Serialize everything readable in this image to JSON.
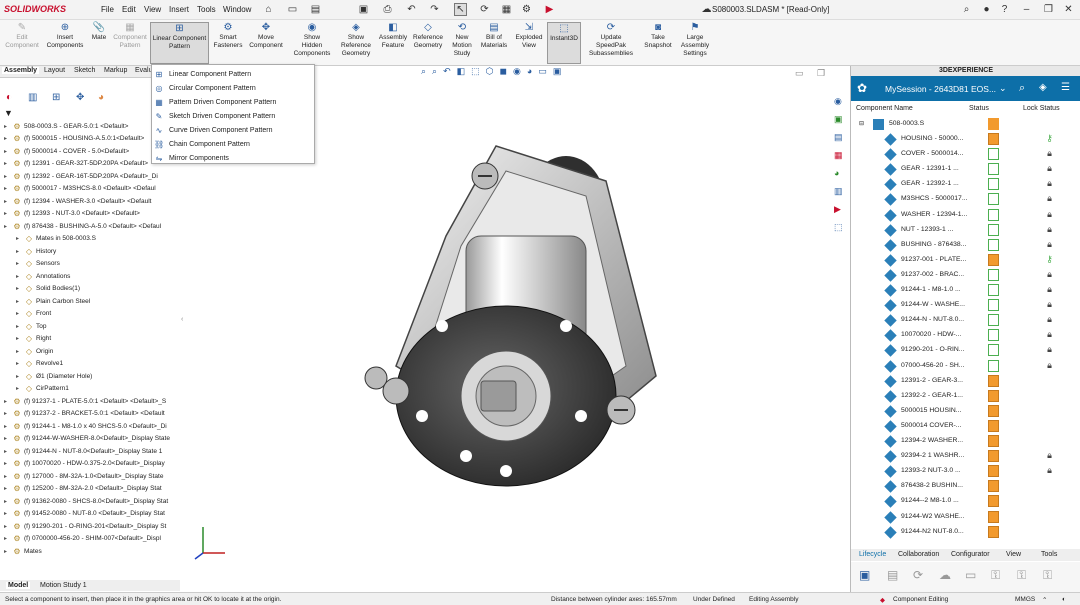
{
  "app": {
    "brand": "SOLIDWORKS",
    "menu": [
      "File",
      "Edit",
      "View",
      "Insert",
      "Tools",
      "Window"
    ],
    "doc_title": "S080003.SLDASM * [Read-Only]"
  },
  "commands": [
    {
      "label": "Edit\nComponent",
      "disabled": true
    },
    {
      "label": "Insert\nComponents",
      "disabled": false
    },
    {
      "label": "Mate",
      "disabled": false
    },
    {
      "label": "Component\nPattern",
      "disabled": true
    },
    {
      "label": "Linear Component\nPattern",
      "disabled": false
    },
    {
      "label": "Smart\nFasteners",
      "disabled": false
    },
    {
      "label": "Move\nComponent",
      "disabled": false
    },
    {
      "label": "Show\nHidden\nComponents",
      "disabled": false
    },
    {
      "label": "Show\nReference\nGeometry",
      "disabled": false
    },
    {
      "label": "Assembly\nFeature",
      "disabled": false
    },
    {
      "label": "Reference\nGeometry",
      "disabled": false
    },
    {
      "label": "New\nMotion\nStudy",
      "disabled": false
    },
    {
      "label": "Bill of\nMaterials",
      "disabled": false
    },
    {
      "label": "Exploded\nView",
      "disabled": false
    },
    {
      "label": "Instant3D",
      "disabled": false
    },
    {
      "label": "Update\nSpeedPak\nSubassemblies",
      "disabled": false
    },
    {
      "label": "Take\nSnapshot",
      "disabled": false
    },
    {
      "label": "Large\nAssembly\nSettings",
      "disabled": false
    }
  ],
  "left_tabs": [
    "Assembly",
    "Layout",
    "Sketch",
    "Markup",
    "Evalu"
  ],
  "dropdown": [
    "Linear Component Pattern",
    "Circular Component Pattern",
    "Pattern Driven Component Pattern",
    "Sketch Driven Component Pattern",
    "Curve Driven Component Pattern",
    "Chain Component Pattern",
    "Mirror Components"
  ],
  "tree": [
    {
      "indent": 0,
      "text": "508-0003.S - GEAR-5.0:1 <Default>"
    },
    {
      "indent": 0,
      "text": "(f) 5000015 - HOUSING-A.5.0:1<Default>"
    },
    {
      "indent": 0,
      "text": "(f) 5000014 - COVER - 5.0<Default>"
    },
    {
      "indent": 0,
      "text": "(f) 12391 - GEAR-32T-5DP.20PA <Default>"
    },
    {
      "indent": 0,
      "text": "(f) 12392 - GEAR-16T-5DP.20PA <Default>_Di"
    },
    {
      "indent": 0,
      "text": "(f) 5000017 - M3SHCS-8.0 <Default> <Defaul"
    },
    {
      "indent": 0,
      "text": "(f) 12394 - WASHER-3.0 <Default> <Default"
    },
    {
      "indent": 0,
      "text": "(f) 12393 - NUT-3.0 <Default> <Default>"
    },
    {
      "indent": 0,
      "text": "(f) 876438 - BUSHING-A-5.0 <Default> <Defaul"
    },
    {
      "indent": 1,
      "text": "Mates in 508-0003.S"
    },
    {
      "indent": 1,
      "text": "History"
    },
    {
      "indent": 1,
      "text": "Sensors"
    },
    {
      "indent": 1,
      "text": "Annotations"
    },
    {
      "indent": 1,
      "text": "Solid Bodies(1)"
    },
    {
      "indent": 1,
      "text": "Plain Carbon Steel"
    },
    {
      "indent": 1,
      "text": "Front"
    },
    {
      "indent": 1,
      "text": "Top"
    },
    {
      "indent": 1,
      "text": "Right"
    },
    {
      "indent": 1,
      "text": "Origin"
    },
    {
      "indent": 1,
      "text": "Revolve1"
    },
    {
      "indent": 1,
      "text": "Ø1 (Diameter Hole)"
    },
    {
      "indent": 1,
      "text": "CirPattern1"
    },
    {
      "indent": 0,
      "text": "(f) 91237-1 - PLATE-5.0:1 <Default> <Default>_S"
    },
    {
      "indent": 0,
      "text": "(f) 91237-2 - BRACKET-5.0:1 <Default> <Default"
    },
    {
      "indent": 0,
      "text": "(f) 91244-1 - M8-1.0 x 40 SHCS-5.0 <Default>_Di"
    },
    {
      "indent": 0,
      "text": "(f) 91244-W-WASHER-8.0<Default>_Display State"
    },
    {
      "indent": 0,
      "text": "(f) 91244-N - NUT-8.0<Default>_Display State 1"
    },
    {
      "indent": 0,
      "text": "(f) 10070020 - HDW-0.375-2.0<Default>_Display"
    },
    {
      "indent": 0,
      "text": "(f) 127000 - 8M-32A-1.0<Default>_Display State"
    },
    {
      "indent": 0,
      "text": "(f) 125200 - 8M-32A-2.0 <Default>_Display Stat"
    },
    {
      "indent": 0,
      "text": "(f) 91362-0080 - SHCS-8.0<Default>_Display Stat"
    },
    {
      "indent": 0,
      "text": "(f) 91452-0080 - NUT-8.0 <Default>_Display Stat"
    },
    {
      "indent": 0,
      "text": "(f) 91290-201 - O-RING-201<Default>_Display St"
    },
    {
      "indent": 0,
      "text": "(f) 0700000-456-20 - SHIM-007<Default>_Displ"
    },
    {
      "indent": 0,
      "text": "Mates"
    }
  ],
  "bottom_tabs": [
    "Model",
    "Motion Study 1"
  ],
  "status": {
    "hint": "Select a component to insert, then place it in the graphics area or hit OK to locate it at the origin.",
    "distance": "Distance between cylinder axes: 165.57mm",
    "defined": "Under Defined",
    "mode": "Editing Assembly",
    "units": "MMGS"
  },
  "panel": {
    "title": "3DEXPERIENCE",
    "session": "MySession - 2643D81 EOS...",
    "cols": [
      "Component Name",
      "Status",
      "Lock Status"
    ],
    "root": "508-0003.S",
    "rows": [
      {
        "name": "HOUSING - 50000...",
        "status": "orange",
        "lock": "key"
      },
      {
        "name": "COVER - 5000014...",
        "status": "green",
        "lock": "lock"
      },
      {
        "name": "GEAR - 12391-1 ...",
        "status": "green",
        "lock": "lock"
      },
      {
        "name": "GEAR - 12392-1 ...",
        "status": "green",
        "lock": "lock"
      },
      {
        "name": "M3SHCS - 5000017...",
        "status": "green",
        "lock": "lock"
      },
      {
        "name": "WASHER - 12394-1...",
        "status": "green",
        "lock": "lock"
      },
      {
        "name": "NUT - 12393-1 ...",
        "status": "green",
        "lock": "lock"
      },
      {
        "name": "BUSHING - 876438...",
        "status": "green",
        "lock": "lock"
      },
      {
        "name": "91237-001 - PLATE...",
        "status": "orange",
        "lock": "key"
      },
      {
        "name": "91237-002 - BRAC...",
        "status": "green",
        "lock": "lock"
      },
      {
        "name": "91244-1 - M8-1.0 ...",
        "status": "green",
        "lock": "lock"
      },
      {
        "name": "91244-W - WASHE...",
        "status": "green",
        "lock": "lock"
      },
      {
        "name": "91244-N - NUT-8.0...",
        "status": "green",
        "lock": "lock"
      },
      {
        "name": "10070020 - HDW-...",
        "status": "green",
        "lock": "lock"
      },
      {
        "name": "91290-201 - O-RIN...",
        "status": "green",
        "lock": "lock"
      },
      {
        "name": "07000-456-20 - SH...",
        "status": "green",
        "lock": "lock"
      },
      {
        "name": "12391-2 - GEAR-3...",
        "status": "orange",
        "lock": ""
      },
      {
        "name": "12392-2 - GEAR-1...",
        "status": "orange",
        "lock": ""
      },
      {
        "name": "5000015 HOUSIN...",
        "status": "orange",
        "lock": ""
      },
      {
        "name": "5000014 COVER-...",
        "status": "orange",
        "lock": ""
      },
      {
        "name": "12394-2 WASHER...",
        "status": "orange",
        "lock": ""
      },
      {
        "name": "92394-2 1 WASHR...",
        "status": "orange",
        "lock": "lock"
      },
      {
        "name": "12393-2 NUT-3.0 ...",
        "status": "orange",
        "lock": "lock"
      },
      {
        "name": "876438-2 BUSHIN...",
        "status": "orange",
        "lock": ""
      },
      {
        "name": "91244--2 M8-1.0 ...",
        "status": "orange",
        "lock": ""
      },
      {
        "name": "91244-W2 WASHE...",
        "status": "orange",
        "lock": ""
      },
      {
        "name": "91244-N2 NUT-8.0...",
        "status": "orange",
        "lock": ""
      }
    ],
    "tabs": [
      "Lifecycle",
      "Collaboration",
      "Configurator",
      "View",
      "Tools"
    ],
    "footer": "Component Editing"
  },
  "colors": {
    "accent": "#0d6fa8",
    "orange": "#f29a2e",
    "green": "#4caf50",
    "brand": "#c8102e"
  }
}
